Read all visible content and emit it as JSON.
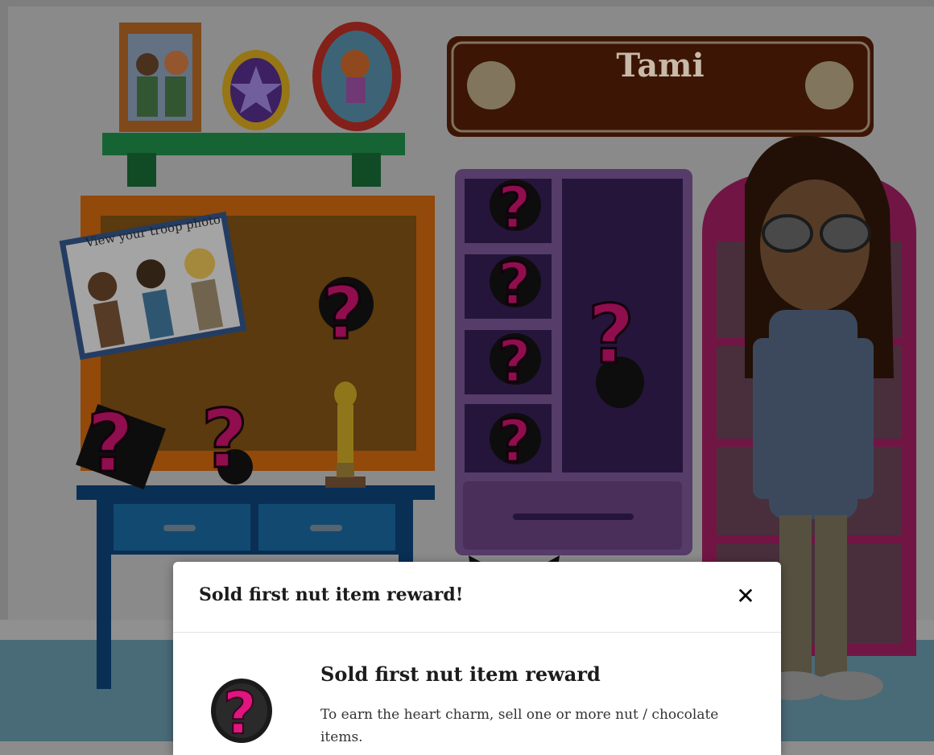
{
  "nameplate": {
    "name": "Tami"
  },
  "troop_photo": {
    "label": "View your troop photo"
  },
  "modal": {
    "title": "Sold first nut item reward!",
    "close_icon": "close-icon",
    "reward": {
      "name": "Sold first nut item reward",
      "description": "To earn the heart charm, sell one or more nut / chocolate items."
    }
  },
  "colors": {
    "overlay": "#000000",
    "locked_item_accent": "#e0157e",
    "nameplate": "#5a1f05",
    "shelf": "#1f8c43"
  }
}
